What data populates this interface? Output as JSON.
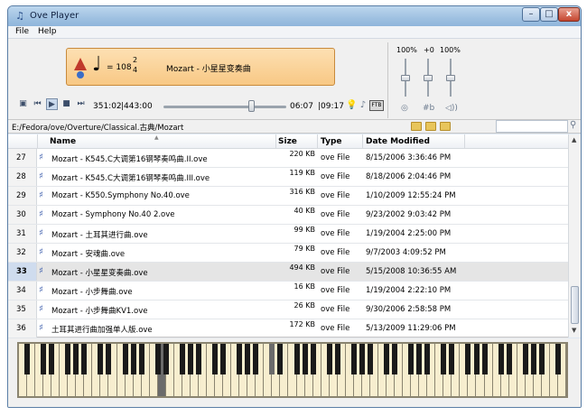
{
  "window": {
    "title": "Ove Player"
  },
  "menu": {
    "file": "File",
    "help": "Help"
  },
  "player": {
    "tempo": "= 108",
    "time_sig_num": "2",
    "time_sig_den": "4",
    "song_title": "Mozart - 小星星变奏曲",
    "time_position": "351:02",
    "time_total": "|443:00",
    "time_end": "06:07",
    "time_end2": "|09:17",
    "seek_position": 0.71,
    "midi_label": "FTB"
  },
  "mixer": {
    "labels": [
      "100%",
      "+0",
      "100%"
    ],
    "icons": [
      "circle-icon",
      "sharp-flat-icon",
      "speaker-icon"
    ],
    "levels": [
      0.5,
      0.5,
      0.5
    ]
  },
  "path": {
    "text": "E:/Fedora/ove/Overture/Classical.古典/Mozart",
    "search_placeholder": ""
  },
  "table": {
    "headers": {
      "name": "Name",
      "size": "Size",
      "type": "Type",
      "modified": "Date Modified"
    },
    "rows": [
      {
        "num": "27",
        "name": "Mozart - K545.C大调第16钢琴奏鸣曲.II.ove",
        "size": "220 KB",
        "type": "ove File",
        "modified": "8/15/2006 3:36:46 PM",
        "selected": false
      },
      {
        "num": "28",
        "name": "Mozart - K545.C大调第16钢琴奏鸣曲.III.ove",
        "size": "119 KB",
        "type": "ove File",
        "modified": "8/18/2006 2:04:46 PM",
        "selected": false
      },
      {
        "num": "29",
        "name": "Mozart - K550.Symphony No.40.ove",
        "size": "316 KB",
        "type": "ove File",
        "modified": "1/10/2009 12:55:24 PM",
        "selected": false
      },
      {
        "num": "30",
        "name": "Mozart - Symphony No.40 2.ove",
        "size": "40 KB",
        "type": "ove File",
        "modified": "9/23/2002 9:03:42 PM",
        "selected": false
      },
      {
        "num": "31",
        "name": "Mozart - 土耳其进行曲.ove",
        "size": "99 KB",
        "type": "ove File",
        "modified": "1/19/2004 2:25:00 PM",
        "selected": false
      },
      {
        "num": "32",
        "name": "Mozart - 安魂曲.ove",
        "size": "79 KB",
        "type": "ove File",
        "modified": "9/7/2003 4:09:52 PM",
        "selected": false
      },
      {
        "num": "33",
        "name": "Mozart - 小星星变奏曲.ove",
        "size": "494 KB",
        "type": "ove File",
        "modified": "5/15/2008 10:36:55 AM",
        "selected": true
      },
      {
        "num": "34",
        "name": "Mozart - 小步舞曲.ove",
        "size": "16 KB",
        "type": "ove File",
        "modified": "1/19/2004 2:22:10 PM",
        "selected": false
      },
      {
        "num": "35",
        "name": "Mozart - 小步舞曲KV1.ove",
        "size": "26 KB",
        "type": "ove File",
        "modified": "9/30/2006 2:58:58 PM",
        "selected": false
      },
      {
        "num": "36",
        "name": "土耳其进行曲加强单人版.ove",
        "size": "172 KB",
        "type": "ove File",
        "modified": "5/13/2009 11:29:06 PM",
        "selected": false
      }
    ]
  },
  "piano": {
    "white_keys": 67,
    "highlighted_white": [
      17
    ],
    "highlighted_black": [
      21
    ]
  },
  "colors": {
    "display_bg": "#f8c884",
    "selected_row": "#e5e5e5",
    "window_border": "#5a7ea6"
  }
}
